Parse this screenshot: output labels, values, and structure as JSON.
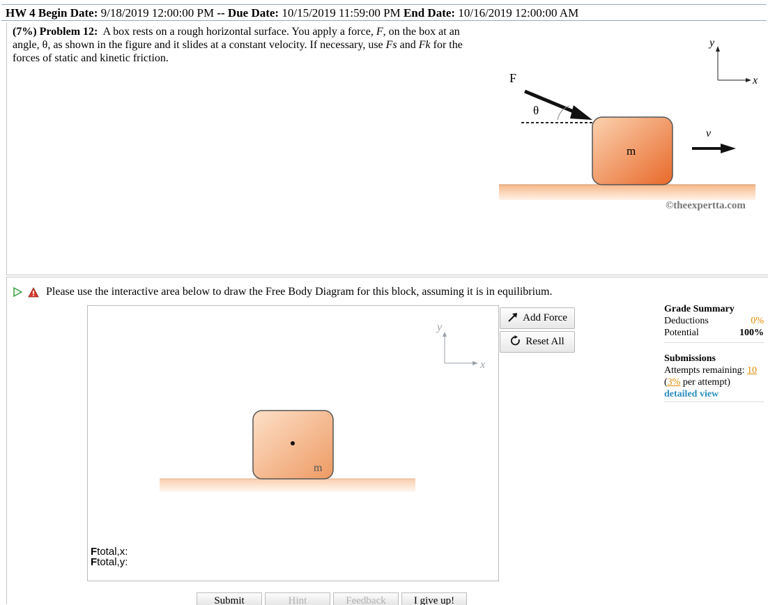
{
  "header": {
    "hw_label": "HW 4 Begin Date:",
    "begin_date": "9/18/2019 12:00:00 PM",
    "sep": "--",
    "due_label": "Due Date:",
    "due_date": "10/15/2019 11:59:00 PM",
    "end_label": "End Date:",
    "end_date": "10/16/2019 12:00:00 AM"
  },
  "problem": {
    "heading": "(7%) Problem 12:",
    "text_1": "A box rests on a rough horizontal surface. You apply a force,",
    "f_var": "F",
    "text_2": ", on the box at an angle, θ, as shown in the figure and it slides at a constant velocity. If necessary, use",
    "fs_var": "Fs",
    "text_3": "and",
    "fk_var": "Fk",
    "text_4": "for the forces of static and kinetic friction."
  },
  "figure": {
    "force_label": "F",
    "theta_label": "θ",
    "mass_label": "m",
    "velocity_label": "v",
    "axis_y": "y",
    "axis_x": "x",
    "copyright": "©theexpertta.com"
  },
  "question": {
    "instruction": "Please use the interactive area below to draw the Free Body Diagram for this block, assuming it is in equilibrium."
  },
  "fbd": {
    "axis_y": "y",
    "axis_x": "x",
    "mass_label": "m",
    "add_force_label": "Add Force",
    "reset_all_label": "Reset All",
    "ftotal_x": {
      "bold": "F",
      "sub": "total,x",
      "suffix": ":"
    },
    "ftotal_y": {
      "bold": "F",
      "sub": "total,y",
      "suffix": ":"
    }
  },
  "grade_summary": {
    "title": "Grade Summary",
    "deductions_label": "Deductions",
    "deductions_value": "0%",
    "potential_label": "Potential",
    "potential_value": "100%"
  },
  "submissions": {
    "title": "Submissions",
    "attempts_label": "Attempts remaining:",
    "attempts_value": "10",
    "per_attempt_open": "(",
    "per_attempt_value": "3%",
    "per_attempt_text": "per attempt)",
    "detailed_view": "detailed view"
  },
  "bottom_buttons": {
    "submit": "Submit",
    "hint": "Hint",
    "feedback": "Feedback",
    "give_up": "I give up!"
  },
  "colors": {
    "accent_orange": "#e08a00",
    "link_blue": "#2a8fc1",
    "box_orange": "#f0a06a",
    "floor": "#fde2c8"
  }
}
